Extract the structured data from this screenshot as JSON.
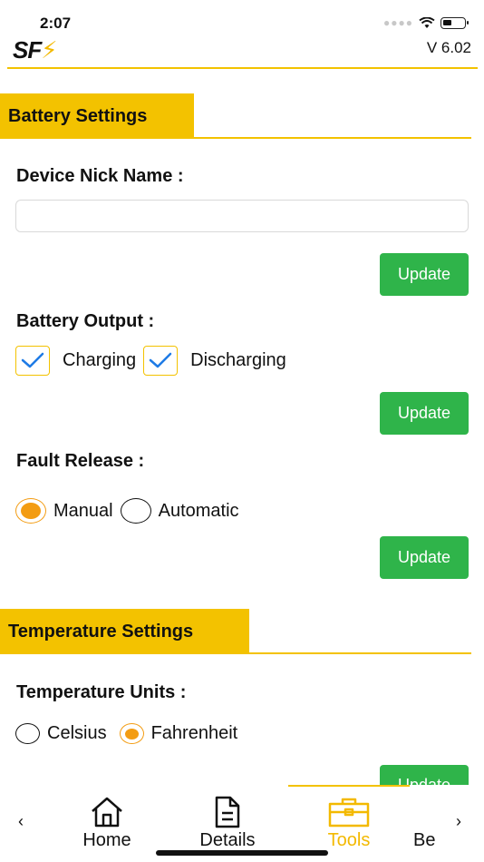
{
  "status": {
    "time": "2:07"
  },
  "header": {
    "logo_text": "SF",
    "logo_mark": "⚡",
    "version": "V 6.02"
  },
  "battery_settings": {
    "title": "Battery Settings",
    "nick_name_label": "Device Nick Name :",
    "nick_name_value": "",
    "update_label": "Update",
    "output_label": "Battery Output :",
    "charging_label": "Charging",
    "charging_checked": true,
    "discharging_label": "Discharging",
    "discharging_checked": true,
    "fault_label": "Fault Release :",
    "manual_label": "Manual",
    "automatic_label": "Automatic",
    "fault_selected": "Manual"
  },
  "temperature_settings": {
    "title": "Temperature Settings",
    "units_label": "Temperature Units :",
    "celsius_label": "Celsius",
    "fahrenheit_label": "Fahrenheit",
    "units_selected": "Fahrenheit",
    "update_label": "Update"
  },
  "tabs": [
    {
      "label": "Home",
      "icon": "home-icon"
    },
    {
      "label": "Details",
      "icon": "document-icon"
    },
    {
      "label": "Tools",
      "icon": "toolbox-icon",
      "active": true
    },
    {
      "label": "Be",
      "icon": ""
    }
  ],
  "colors": {
    "accent": "#f3c200",
    "button": "#2fb44a",
    "radio": "#f39c12",
    "check": "#1e7be6"
  }
}
